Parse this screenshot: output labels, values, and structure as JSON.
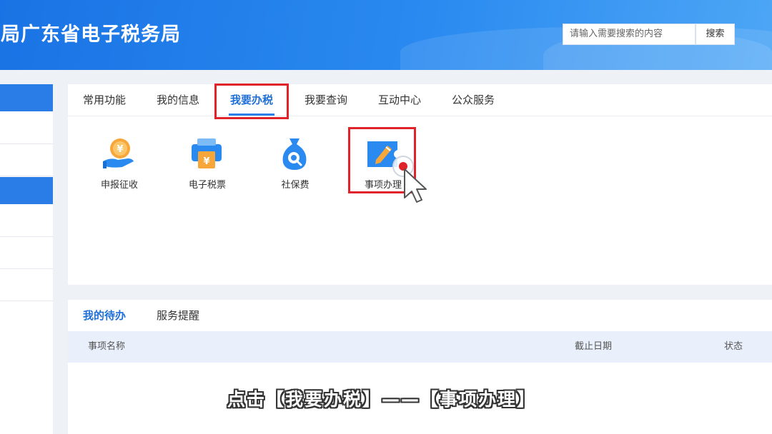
{
  "header": {
    "site_title": "总局广东省电子税务局",
    "search_placeholder": "请输入需要搜索的内容",
    "search_button": "搜索"
  },
  "main_tabs": [
    {
      "label": "常用功能"
    },
    {
      "label": "我的信息"
    },
    {
      "label": "我要办税",
      "active": true
    },
    {
      "label": "我要查询"
    },
    {
      "label": "互动中心"
    },
    {
      "label": "公众服务"
    }
  ],
  "functions": [
    {
      "label": "申报征收",
      "icon": "coin-hand-icon"
    },
    {
      "label": "电子税票",
      "icon": "printer-ticket-icon"
    },
    {
      "label": "社保费",
      "icon": "money-bag-icon"
    },
    {
      "label": "事项办理",
      "icon": "edit-ticket-icon"
    }
  ],
  "todo": {
    "tabs": [
      {
        "label": "我的待办",
        "active": true
      },
      {
        "label": "服务提醒"
      }
    ],
    "columns": [
      "事项名称",
      "截止日期",
      "状态"
    ]
  },
  "subtitle": "点击【我要办税】——【事项办理】",
  "colors": {
    "accent": "#2a7ce6",
    "highlight": "#e0222a"
  }
}
